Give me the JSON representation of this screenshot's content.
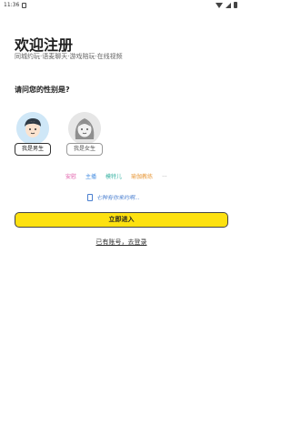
{
  "status_bar": {
    "time": "11:36"
  },
  "header": {
    "title": "欢迎注册",
    "subtitle": "同城约玩·语麦聊天·游戏陪玩·在线视频"
  },
  "gender": {
    "question": "请问您的性别是?",
    "male_label": "我是男生",
    "female_label": "我是女生"
  },
  "tags": [
    {
      "label": "安慰",
      "color": "#e05aa8"
    },
    {
      "label": "主播",
      "color": "#4a90e2"
    },
    {
      "label": "模特儿",
      "color": "#3bb3a4"
    },
    {
      "label": "瑜伽教练",
      "color": "#e89a3c"
    },
    {
      "label": "...",
      "color": "#9a9a9a"
    }
  ],
  "notice": {
    "text": "七种有你来约啊..."
  },
  "actions": {
    "enter_label": "立即进入",
    "login_label": "已有账号，去登录"
  }
}
